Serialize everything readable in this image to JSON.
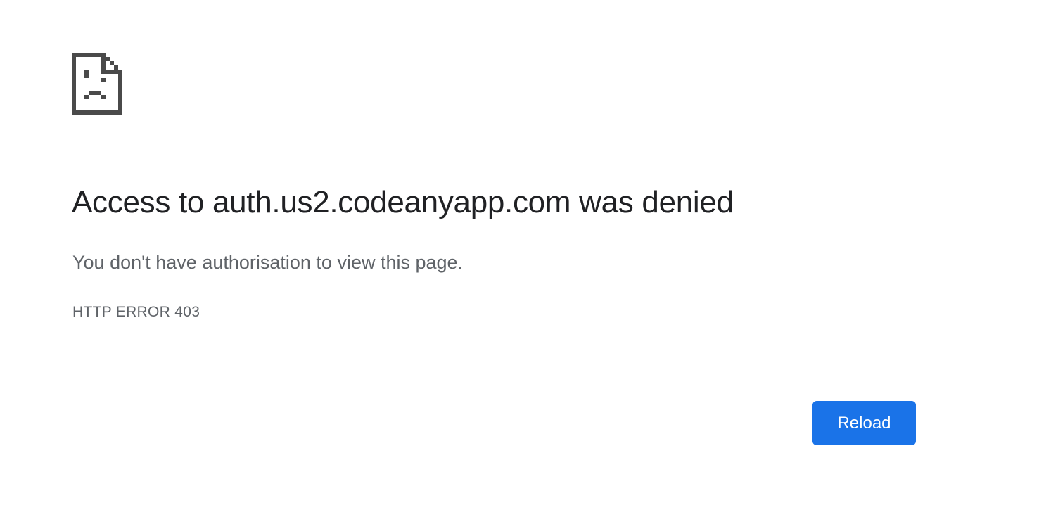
{
  "error": {
    "icon": "sad-document-icon",
    "title": "Access to auth.us2.codeanyapp.com was denied",
    "message": "You don't have authorisation to view this page.",
    "code": "HTTP ERROR 403"
  },
  "actions": {
    "reload_label": "Reload"
  },
  "colors": {
    "title": "#202124",
    "secondary_text": "#5f6368",
    "button_background": "#1a73e8",
    "button_text": "#ffffff",
    "icon": "#4a4a4a"
  }
}
